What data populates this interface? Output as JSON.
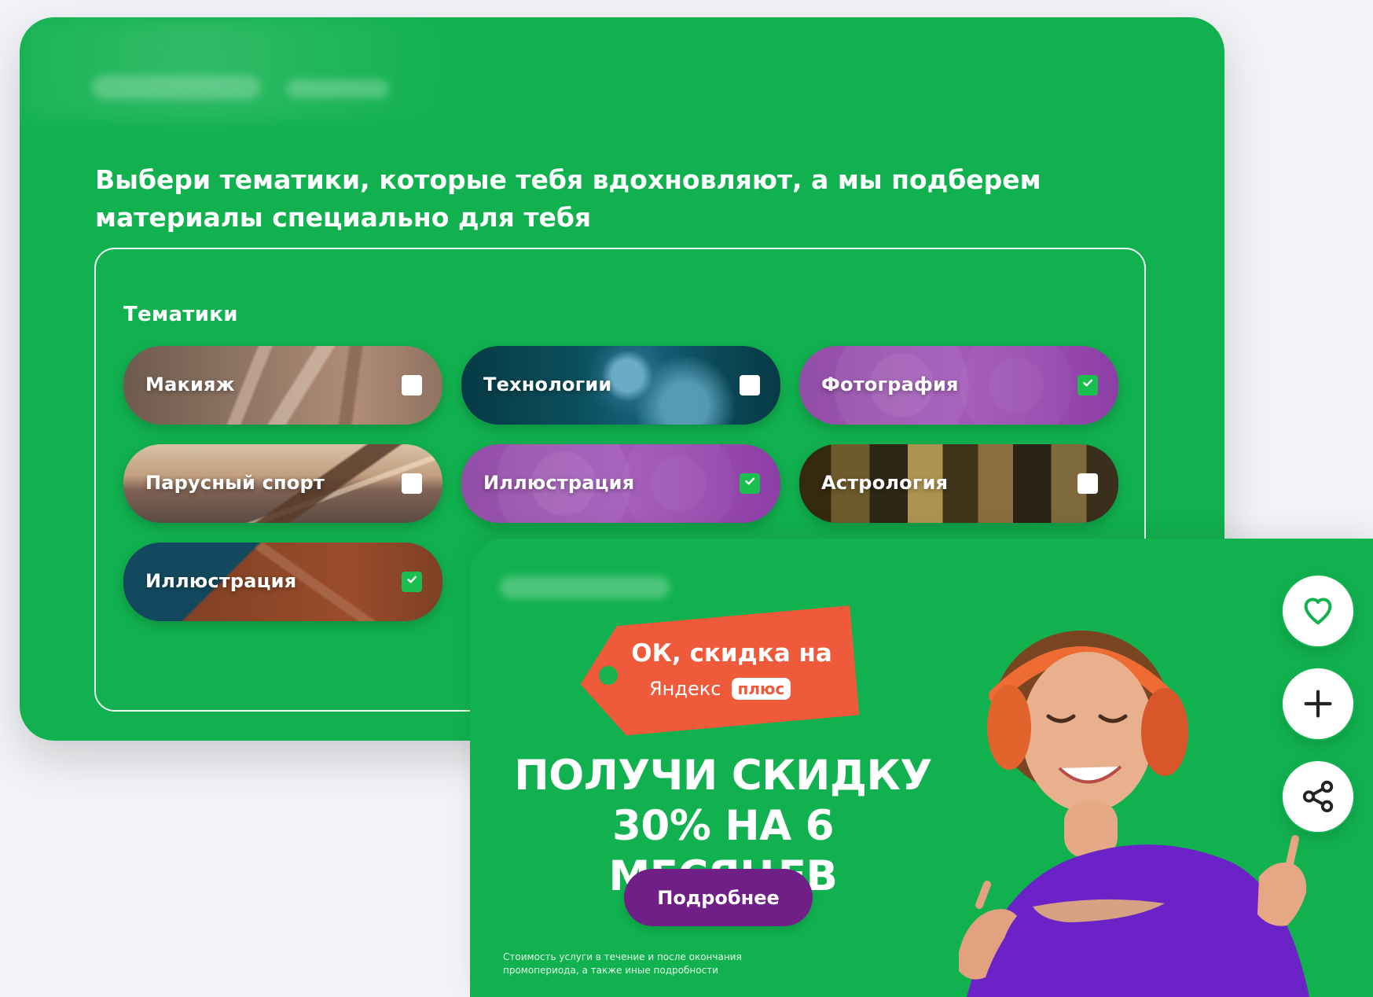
{
  "topic_card": {
    "heading": "Выбери тематики, которые тебя вдохновляют, а мы подберем материалы специально для тебя",
    "section_title": "Тематики",
    "topics": [
      {
        "label": "Макияж",
        "checked": false
      },
      {
        "label": "Технологии",
        "checked": false
      },
      {
        "label": "Фотография",
        "checked": true
      },
      {
        "label": "Парусный спорт",
        "checked": false
      },
      {
        "label": "Иллюстрация",
        "checked": true
      },
      {
        "label": "Астрология",
        "checked": false
      },
      {
        "label": "Иллюстрация",
        "checked": true
      }
    ]
  },
  "ad_card": {
    "tag_line1": "ОК, скидка на",
    "tag_brand": "Яндекс",
    "tag_plus": "плюс",
    "headline_line1": "ПОЛУЧИ СКИДКУ",
    "headline_line2": "30% НА 6 МЕСЯЦЕВ",
    "button_label": "Подробнее",
    "fineprint_line1": "Стоимость услуги в течение и после окончания",
    "fineprint_line2": "промопериода, а также иные подробности"
  },
  "colors": {
    "brand_green": "#11b14f",
    "offer_orange": "#ef5a3b",
    "accent_purple": "#6f1f86"
  },
  "icons": {
    "favorite": "heart-icon",
    "add": "plus-icon",
    "share": "share-icon"
  }
}
